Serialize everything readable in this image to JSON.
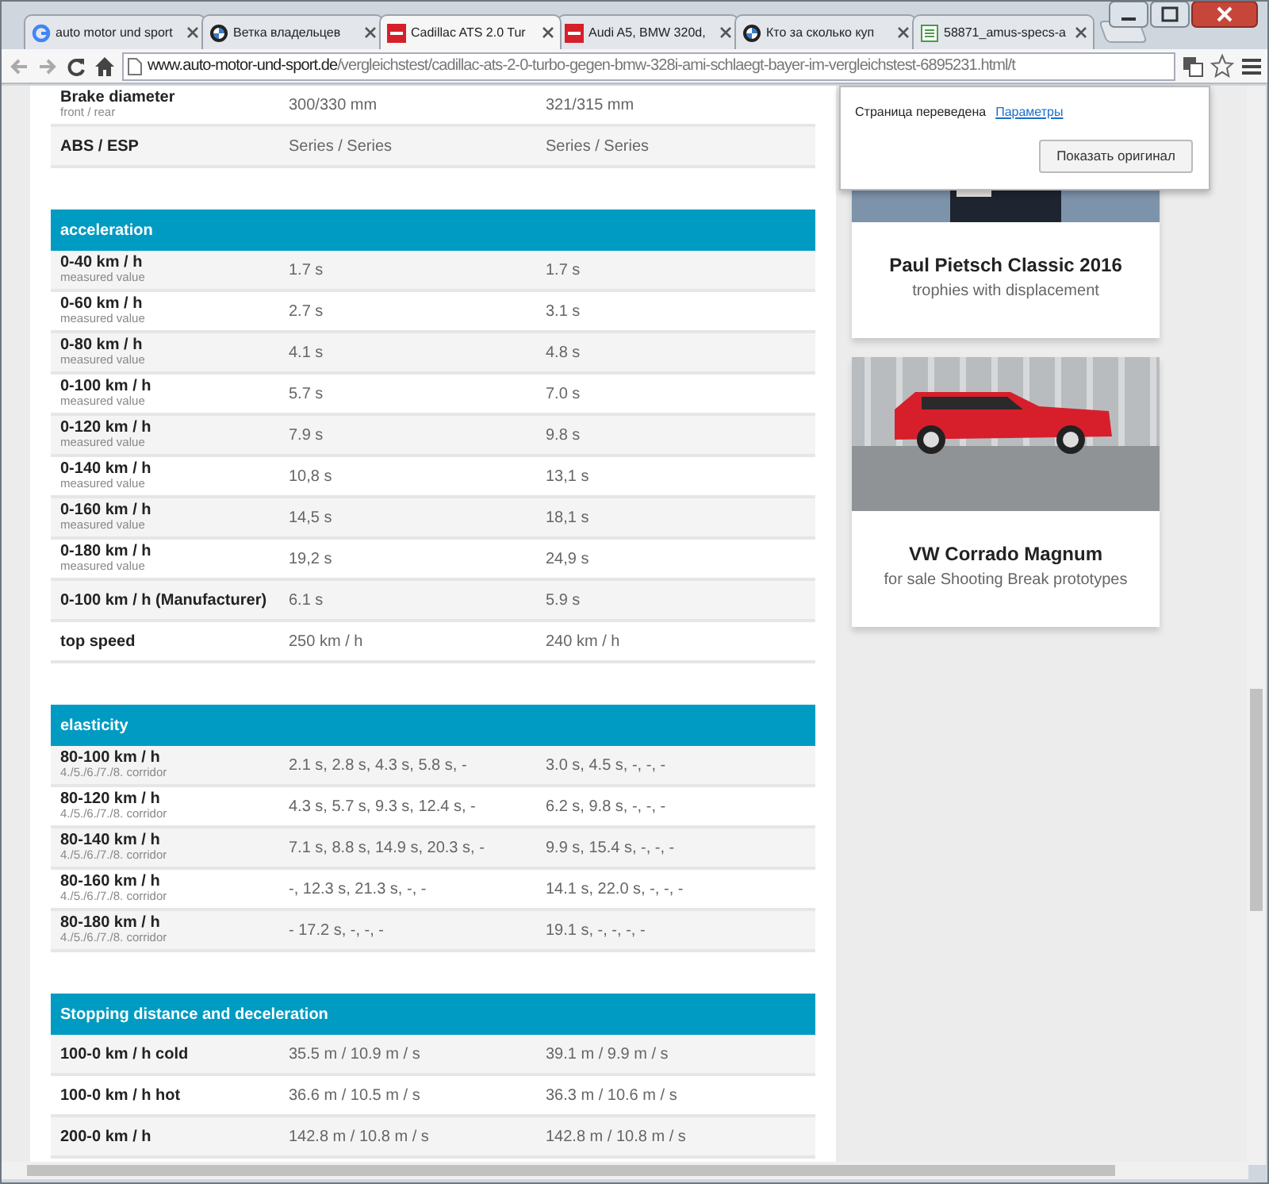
{
  "browser": {
    "tabs": [
      {
        "title": "auto motor und sport",
        "kind": "google",
        "selected": false
      },
      {
        "title": "Ветка владельцев",
        "kind": "bmw",
        "selected": false
      },
      {
        "title": "Cadillac ATS 2.0 Tur",
        "kind": "ams",
        "selected": true
      },
      {
        "title": "Audi A5, BMW 320d,",
        "kind": "ams",
        "selected": false
      },
      {
        "title": "Кто за сколько куп",
        "kind": "bmw",
        "selected": false
      },
      {
        "title": "58871_amus-specs-a",
        "kind": "doc",
        "selected": false
      }
    ],
    "url_host": "www.auto-motor-und-sport.de",
    "url_path": "/vergleichstest/cadillac-ats-2-0-turbo-gegen-bmw-328i-ami-schlaegt-bayer-im-vergleichstest-6895231.html/t"
  },
  "translate_popup": {
    "message": "Страница переведена",
    "link": "Параметры",
    "button": "Показать оригинал"
  },
  "top_rows": [
    {
      "label": "Brake diameter",
      "note": "front / rear",
      "values": [
        "300/330 mm",
        "321/315 mm"
      ]
    },
    {
      "label": "ABS / ESP",
      "values": [
        "Series / Series",
        "Series / Series"
      ]
    }
  ],
  "sections": [
    {
      "title": "acceleration",
      "rows": [
        {
          "label": "0-40 km / h",
          "note": "measured value",
          "values": [
            "1.7 s",
            "1.7 s"
          ]
        },
        {
          "label": "0-60 km / h",
          "note": "measured value",
          "values": [
            "2.7 s",
            "3.1 s"
          ]
        },
        {
          "label": "0-80 km / h",
          "note": "measured value",
          "values": [
            "4.1 s",
            "4.8 s"
          ]
        },
        {
          "label": "0-100 km / h",
          "note": "measured value",
          "values": [
            "5.7 s",
            "7.0 s"
          ]
        },
        {
          "label": "0-120 km / h",
          "note": "measured value",
          "values": [
            "7.9 s",
            "9.8 s"
          ]
        },
        {
          "label": "0-140 km / h",
          "note": "measured value",
          "values": [
            "10,8 s",
            "13,1 s"
          ]
        },
        {
          "label": "0-160 km / h",
          "note": "measured value",
          "values": [
            "14,5 s",
            "18,1 s"
          ]
        },
        {
          "label": "0-180 km / h",
          "note": "measured value",
          "values": [
            "19,2 s",
            "24,9 s"
          ]
        },
        {
          "label": "0-100 km / h (Manufacturer)",
          "values": [
            "6.1 s",
            "5.9 s"
          ]
        },
        {
          "label": "top speed",
          "values": [
            "250 km / h",
            "240 km / h"
          ]
        }
      ]
    },
    {
      "title": "elasticity",
      "rows": [
        {
          "label": "80-100 km / h",
          "note": "4./5./6./7./8. corridor",
          "values": [
            "2.1 s, 2.8 s, 4.3 s, 5.8 s, -",
            "3.0 s, 4.5 s, -, -, -"
          ]
        },
        {
          "label": "80-120 km / h",
          "note": "4./5./6./7./8. corridor",
          "values": [
            "4.3 s, 5.7 s, 9.3 s, 12.4 s, -",
            "6.2 s, 9.8 s, -, -, -"
          ]
        },
        {
          "label": "80-140 km / h",
          "note": "4./5./6./7./8. corridor",
          "values": [
            "7.1 s, 8.8 s, 14.9 s, 20.3 s, -",
            "9.9 s, 15.4 s, -, -, -"
          ]
        },
        {
          "label": "80-160 km / h",
          "note": "4./5./6./7./8. corridor",
          "values": [
            "-, 12.3 s, 21.3 s, -, -",
            "14.1 s, 22.0 s, -, -, -"
          ]
        },
        {
          "label": "80-180 km / h",
          "note": "4./5./6./7./8. corridor",
          "values": [
            "- 17.2 s, -, -, -",
            "19.1 s, -, -, -, -"
          ]
        }
      ]
    },
    {
      "title": "Stopping distance and deceleration",
      "rows": [
        {
          "label": "100-0 km / h cold",
          "values": [
            "35.5 m / 10.9 m / s",
            "39.1 m / 9.9 m / s"
          ]
        },
        {
          "label": "100-0 km / h hot",
          "values": [
            "36.6 m / 10.5 m / s",
            "36.3 m / 10.6 m / s"
          ]
        },
        {
          "label": "200-0 km / h",
          "values": [
            "142.8 m / 10.8 m / s",
            "142.8 m / 10.8 m / s"
          ]
        }
      ]
    }
  ],
  "sidebar_cards": [
    {
      "title": "Paul Pietsch Classic 2016",
      "subtitle": "trophies with displacement"
    },
    {
      "title": "VW Corrado Magnum",
      "subtitle": "for sale Shooting Break prototypes"
    }
  ]
}
